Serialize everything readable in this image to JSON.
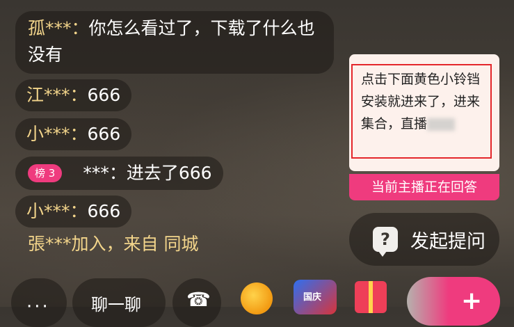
{
  "chat": {
    "messages": [
      {
        "user": "孤***：",
        "text": "你怎么看过了，下载了什么也没有"
      },
      {
        "user": "江***：",
        "text": "666"
      },
      {
        "user": "小***：",
        "text": "666"
      },
      {
        "badge": "榜 3",
        "user": "***：",
        "text": "进去了666"
      },
      {
        "user": "小***：",
        "text": "666"
      }
    ],
    "join_text": "張***加入，来自 同城"
  },
  "notice": {
    "text": "点击下面黄色小铃铛安装就进来了，进来集合，直播",
    "status": "当前主播正在回答"
  },
  "ask_button": {
    "icon": "question-bubble-icon",
    "label": "发起提问"
  },
  "bottom_bar": {
    "more_label": "···",
    "chat_label": "聊一聊",
    "call_icon": "video-call-icon",
    "gift2_label": "国庆",
    "plus_label": "+"
  },
  "colors": {
    "accent": "#ef3b7e",
    "username": "#f3d58b",
    "notice_border": "#e4262a"
  }
}
